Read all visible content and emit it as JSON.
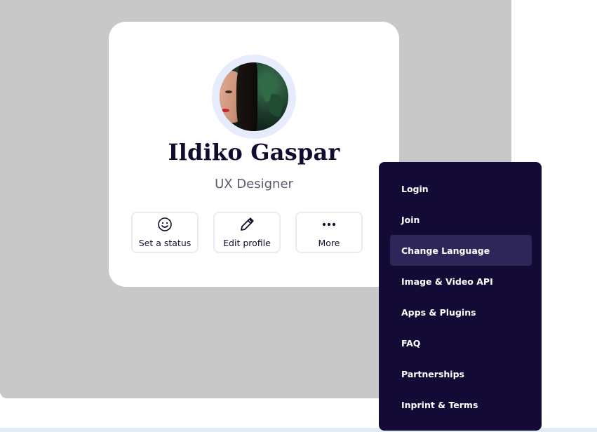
{
  "profile": {
    "name": "Ildiko Gaspar",
    "role": "UX Designer"
  },
  "actions": [
    {
      "label": "Set a status",
      "icon": "smiley-icon"
    },
    {
      "label": "Edit profile",
      "icon": "pencil-icon"
    },
    {
      "label": "More",
      "icon": "more-dots-icon"
    }
  ],
  "menu": {
    "active_index": 2,
    "items": [
      {
        "label": "Login"
      },
      {
        "label": "Join"
      },
      {
        "label": "Change Language"
      },
      {
        "label": "Image & Video API"
      },
      {
        "label": "Apps & Plugins"
      },
      {
        "label": "FAQ"
      },
      {
        "label": "Partnerships"
      },
      {
        "label": "Inprint & Terms"
      }
    ]
  },
  "colors": {
    "backdrop": "#c8c8c8",
    "menu_bg": "#130b35",
    "menu_active": "#2e2658",
    "text_dark": "#120b2e",
    "avatar_ring": "#e6ecfb"
  }
}
